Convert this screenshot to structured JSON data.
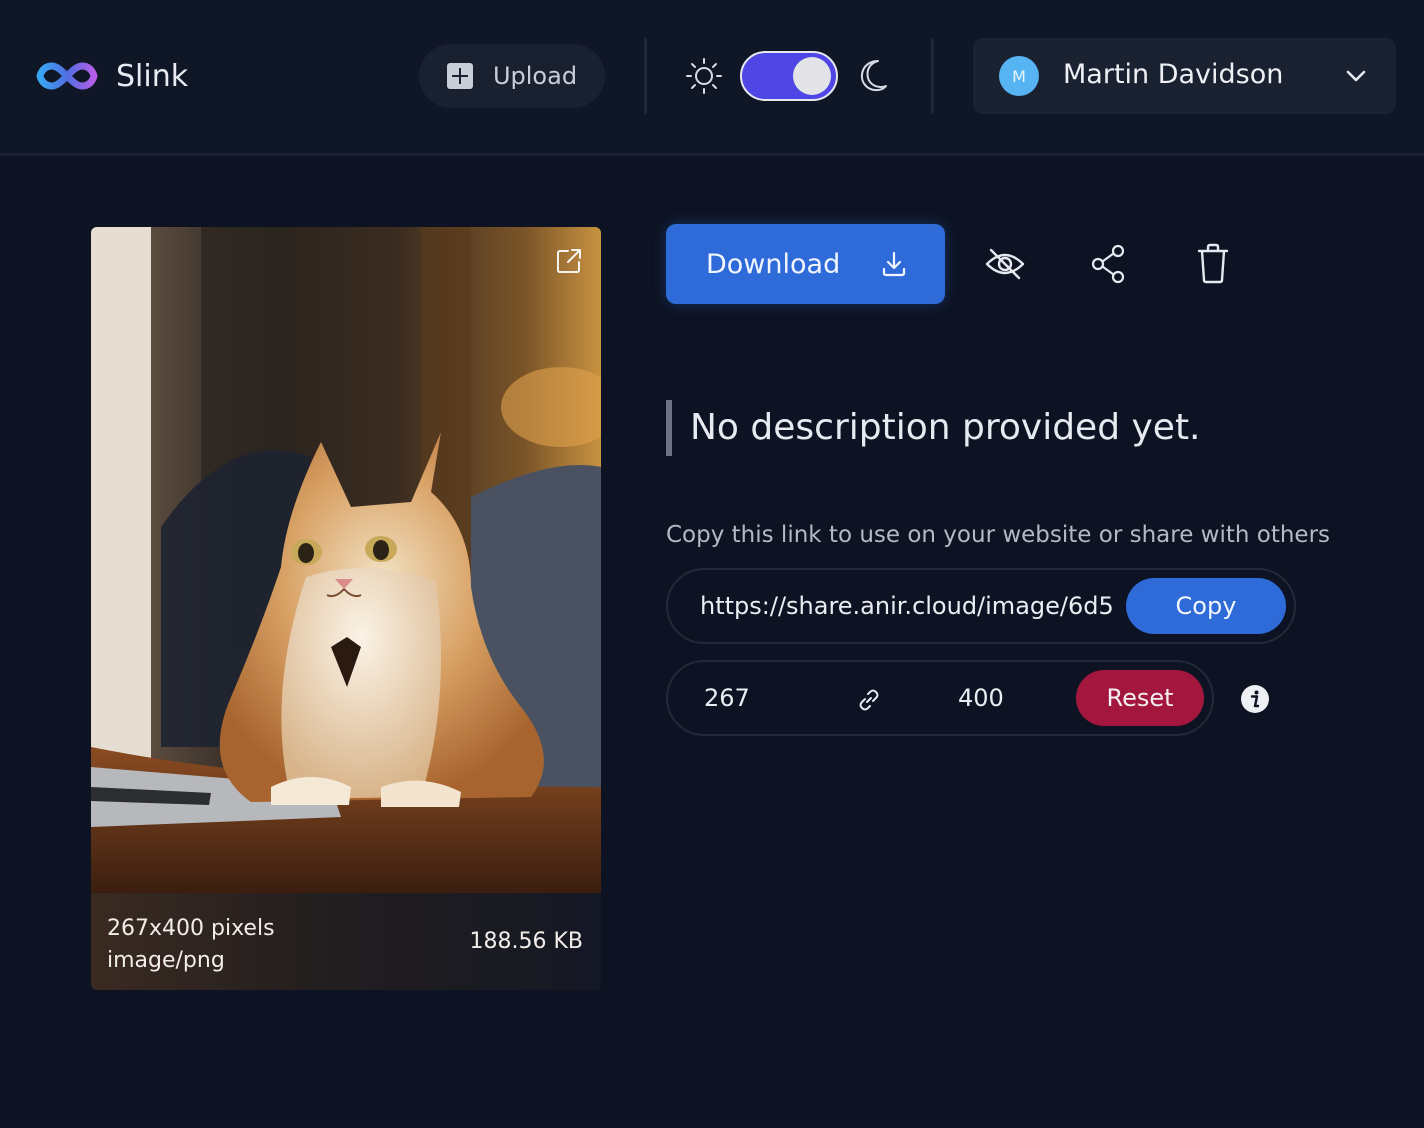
{
  "app": {
    "name": "Slink"
  },
  "header": {
    "upload_label": "Upload",
    "theme_dark_enabled": true,
    "user": {
      "name": "Martin Davidson",
      "initial": "M"
    }
  },
  "image": {
    "dimensions_text": "267x400 pixels",
    "mime_type": "image/png",
    "file_size": "188.56 KB"
  },
  "actions": {
    "download_label": "Download"
  },
  "description": "No description provided yet.",
  "share": {
    "hint": "Copy this link to use on your website or share with others",
    "url": "https://share.anir.cloud/image/6d5",
    "copy_label": "Copy"
  },
  "resize": {
    "width": "267",
    "height": "400",
    "reset_label": "Reset"
  },
  "colors": {
    "background": "#0d1322",
    "accent_blue": "#2f6bd8",
    "toggle_indigo": "#4f46e5",
    "reset_red": "#a3163d"
  },
  "icons": [
    "infinity-logo-icon",
    "plus-square-icon",
    "sun-icon",
    "moon-icon",
    "chevron-down-icon",
    "external-link-icon",
    "download-icon",
    "eye-off-icon",
    "share-icon",
    "trash-icon",
    "link-icon",
    "info-icon"
  ]
}
